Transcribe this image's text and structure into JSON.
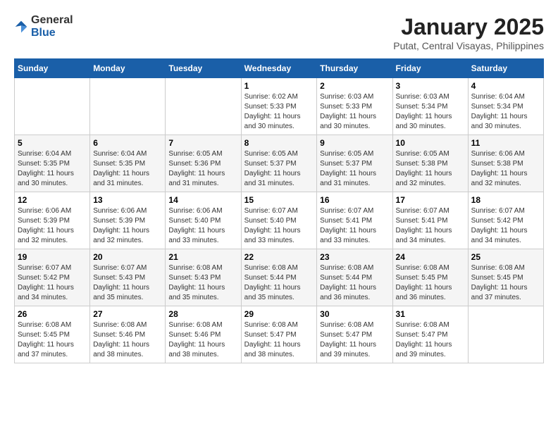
{
  "logo": {
    "general": "General",
    "blue": "Blue"
  },
  "header": {
    "title": "January 2025",
    "subtitle": "Putat, Central Visayas, Philippines"
  },
  "weekdays": [
    "Sunday",
    "Monday",
    "Tuesday",
    "Wednesday",
    "Thursday",
    "Friday",
    "Saturday"
  ],
  "weeks": [
    [
      {
        "day": "",
        "info": ""
      },
      {
        "day": "",
        "info": ""
      },
      {
        "day": "",
        "info": ""
      },
      {
        "day": "1",
        "info": "Sunrise: 6:02 AM\nSunset: 5:33 PM\nDaylight: 11 hours\nand 30 minutes."
      },
      {
        "day": "2",
        "info": "Sunrise: 6:03 AM\nSunset: 5:33 PM\nDaylight: 11 hours\nand 30 minutes."
      },
      {
        "day": "3",
        "info": "Sunrise: 6:03 AM\nSunset: 5:34 PM\nDaylight: 11 hours\nand 30 minutes."
      },
      {
        "day": "4",
        "info": "Sunrise: 6:04 AM\nSunset: 5:34 PM\nDaylight: 11 hours\nand 30 minutes."
      }
    ],
    [
      {
        "day": "5",
        "info": "Sunrise: 6:04 AM\nSunset: 5:35 PM\nDaylight: 11 hours\nand 30 minutes."
      },
      {
        "day": "6",
        "info": "Sunrise: 6:04 AM\nSunset: 5:35 PM\nDaylight: 11 hours\nand 31 minutes."
      },
      {
        "day": "7",
        "info": "Sunrise: 6:05 AM\nSunset: 5:36 PM\nDaylight: 11 hours\nand 31 minutes."
      },
      {
        "day": "8",
        "info": "Sunrise: 6:05 AM\nSunset: 5:37 PM\nDaylight: 11 hours\nand 31 minutes."
      },
      {
        "day": "9",
        "info": "Sunrise: 6:05 AM\nSunset: 5:37 PM\nDaylight: 11 hours\nand 31 minutes."
      },
      {
        "day": "10",
        "info": "Sunrise: 6:05 AM\nSunset: 5:38 PM\nDaylight: 11 hours\nand 32 minutes."
      },
      {
        "day": "11",
        "info": "Sunrise: 6:06 AM\nSunset: 5:38 PM\nDaylight: 11 hours\nand 32 minutes."
      }
    ],
    [
      {
        "day": "12",
        "info": "Sunrise: 6:06 AM\nSunset: 5:39 PM\nDaylight: 11 hours\nand 32 minutes."
      },
      {
        "day": "13",
        "info": "Sunrise: 6:06 AM\nSunset: 5:39 PM\nDaylight: 11 hours\nand 32 minutes."
      },
      {
        "day": "14",
        "info": "Sunrise: 6:06 AM\nSunset: 5:40 PM\nDaylight: 11 hours\nand 33 minutes."
      },
      {
        "day": "15",
        "info": "Sunrise: 6:07 AM\nSunset: 5:40 PM\nDaylight: 11 hours\nand 33 minutes."
      },
      {
        "day": "16",
        "info": "Sunrise: 6:07 AM\nSunset: 5:41 PM\nDaylight: 11 hours\nand 33 minutes."
      },
      {
        "day": "17",
        "info": "Sunrise: 6:07 AM\nSunset: 5:41 PM\nDaylight: 11 hours\nand 34 minutes."
      },
      {
        "day": "18",
        "info": "Sunrise: 6:07 AM\nSunset: 5:42 PM\nDaylight: 11 hours\nand 34 minutes."
      }
    ],
    [
      {
        "day": "19",
        "info": "Sunrise: 6:07 AM\nSunset: 5:42 PM\nDaylight: 11 hours\nand 34 minutes."
      },
      {
        "day": "20",
        "info": "Sunrise: 6:07 AM\nSunset: 5:43 PM\nDaylight: 11 hours\nand 35 minutes."
      },
      {
        "day": "21",
        "info": "Sunrise: 6:08 AM\nSunset: 5:43 PM\nDaylight: 11 hours\nand 35 minutes."
      },
      {
        "day": "22",
        "info": "Sunrise: 6:08 AM\nSunset: 5:44 PM\nDaylight: 11 hours\nand 35 minutes."
      },
      {
        "day": "23",
        "info": "Sunrise: 6:08 AM\nSunset: 5:44 PM\nDaylight: 11 hours\nand 36 minutes."
      },
      {
        "day": "24",
        "info": "Sunrise: 6:08 AM\nSunset: 5:45 PM\nDaylight: 11 hours\nand 36 minutes."
      },
      {
        "day": "25",
        "info": "Sunrise: 6:08 AM\nSunset: 5:45 PM\nDaylight: 11 hours\nand 37 minutes."
      }
    ],
    [
      {
        "day": "26",
        "info": "Sunrise: 6:08 AM\nSunset: 5:45 PM\nDaylight: 11 hours\nand 37 minutes."
      },
      {
        "day": "27",
        "info": "Sunrise: 6:08 AM\nSunset: 5:46 PM\nDaylight: 11 hours\nand 38 minutes."
      },
      {
        "day": "28",
        "info": "Sunrise: 6:08 AM\nSunset: 5:46 PM\nDaylight: 11 hours\nand 38 minutes."
      },
      {
        "day": "29",
        "info": "Sunrise: 6:08 AM\nSunset: 5:47 PM\nDaylight: 11 hours\nand 38 minutes."
      },
      {
        "day": "30",
        "info": "Sunrise: 6:08 AM\nSunset: 5:47 PM\nDaylight: 11 hours\nand 39 minutes."
      },
      {
        "day": "31",
        "info": "Sunrise: 6:08 AM\nSunset: 5:47 PM\nDaylight: 11 hours\nand 39 minutes."
      },
      {
        "day": "",
        "info": ""
      }
    ]
  ]
}
